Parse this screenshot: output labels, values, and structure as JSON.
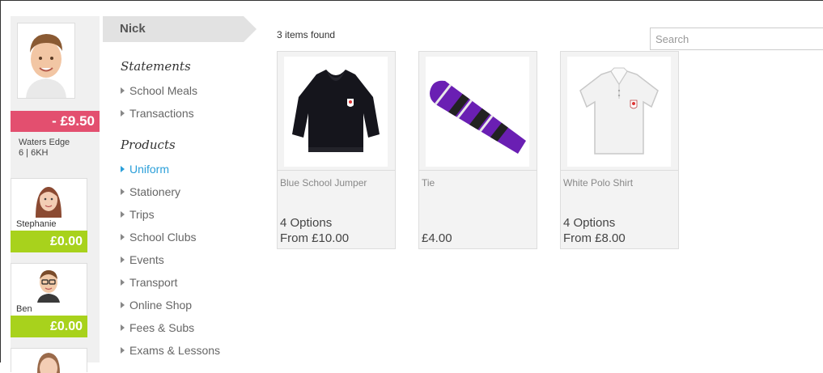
{
  "child": {
    "name": "Nick",
    "balance": "- £9.50",
    "school": "Waters Edge",
    "class": "6 | 6KH"
  },
  "siblings": [
    {
      "name": "Stephanie",
      "balance": "£0.00"
    },
    {
      "name": "Ben",
      "balance": "£0.00"
    }
  ],
  "nav": {
    "statements_heading": "Statements",
    "statements": [
      "School Meals",
      "Transactions"
    ],
    "products_heading": "Products",
    "products": [
      "Uniform",
      "Stationery",
      "Trips",
      "School Clubs",
      "Events",
      "Transport",
      "Online Shop",
      "Fees & Subs",
      "Exams & Lessons"
    ],
    "active_product": "Uniform"
  },
  "main": {
    "results_text": "3 items found",
    "search_placeholder": "Search"
  },
  "products": [
    {
      "title": "Blue School Jumper",
      "options": "4 Options",
      "price": "From £10.00",
      "icon": "jumper-image"
    },
    {
      "title": "Tie",
      "options": "",
      "price": "£4.00",
      "icon": "tie-image"
    },
    {
      "title": "White Polo Shirt",
      "options": "4 Options",
      "price": "From £8.00",
      "icon": "polo-shirt-image"
    }
  ],
  "colors": {
    "negative_balance": "#e34f6f",
    "zero_balance": "#a8d21c",
    "active_link": "#2b9fd9"
  }
}
